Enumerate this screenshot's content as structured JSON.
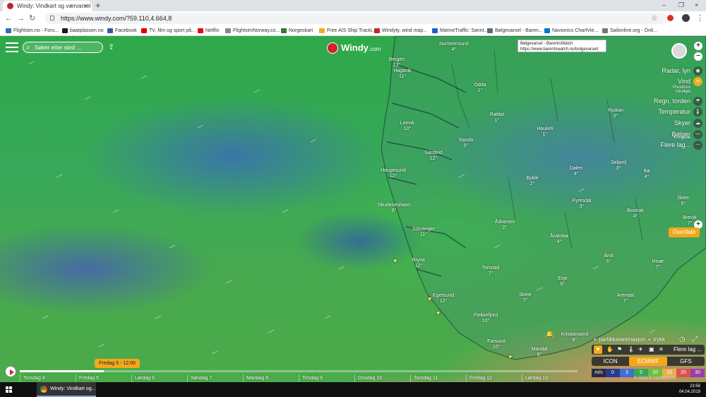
{
  "browser": {
    "tab_title": "Windy: Vindkart og værvarsel",
    "tab_close": "×",
    "new_tab": "+",
    "url": "https://www.windy.com/?59.110,4.664,8",
    "window_controls": [
      "–",
      "❐",
      "×"
    ],
    "bookmarks": [
      {
        "label": "Flightsim.no - Foru...",
        "color": "#2d6db5"
      },
      {
        "label": "baatplassen.no",
        "color": "#1a1a1a"
      },
      {
        "label": "Facebook",
        "color": "#3b5998"
      },
      {
        "label": "TV, film og sport på...",
        "color": "#e00000"
      },
      {
        "label": "Netflix",
        "color": "#e50914"
      },
      {
        "label": "FlightsimNorway.co...",
        "color": "#888888"
      },
      {
        "label": "Norgeskart",
        "color": "#2e7d32"
      },
      {
        "label": "Free AIS Ship Tracki...",
        "color": "#f9a825"
      },
      {
        "label": "Windyty, wind map...",
        "color": "#c0262b"
      },
      {
        "label": "MarineTraffic: Sannt...",
        "color": "#1565c0"
      },
      {
        "label": "Bølgevarsel - Baren...",
        "color": "#546e7a"
      },
      {
        "label": "Navionics ChartVie...",
        "color": "#0277bd"
      },
      {
        "label": "Sailonline.org - Onli...",
        "color": "#777777"
      }
    ]
  },
  "map": {
    "search_placeholder": "Søker etter sted ...",
    "logo_main": "Windy",
    "logo_suffix": ".com",
    "tooltip_title": "Bølgevarsel - BarentsWatch",
    "tooltip_url": "https://www.barentswatch.no/bolgevarsel/",
    "cities": [
      {
        "name": "Bergen",
        "temp": "13°"
      },
      {
        "name": "Norheimsund",
        "temp": "4°"
      },
      {
        "name": "Hagavik",
        "temp": "11°"
      },
      {
        "name": "Odda",
        "temp": "1°"
      },
      {
        "name": "Røldal",
        "temp": "1°"
      },
      {
        "name": "Rjukan",
        "temp": "0°"
      },
      {
        "name": "Leirvik",
        "temp": "10°"
      },
      {
        "name": "Haukeli",
        "temp": "1°"
      },
      {
        "name": "Sauda",
        "temp": "5°"
      },
      {
        "name": "Sandeid",
        "temp": "12°"
      },
      {
        "name": "Haugesund",
        "temp": "12°"
      },
      {
        "name": "Dalen",
        "temp": "4°"
      },
      {
        "name": "Seljord",
        "temp": "3°"
      },
      {
        "name": "Bø",
        "temp": "4°"
      },
      {
        "name": "Bykle",
        "temp": "2°"
      },
      {
        "name": "Skudeneshavn",
        "temp": "9°"
      },
      {
        "name": "Fyresdal",
        "temp": "3°"
      },
      {
        "name": "Skien",
        "temp": "6°"
      },
      {
        "name": "Bostrak",
        "temp": "4°"
      },
      {
        "name": "Brevik",
        "temp": "7°"
      },
      {
        "name": "Ådneram",
        "temp": "2°"
      },
      {
        "name": "Stavanger",
        "temp": "11°"
      },
      {
        "name": "Åraksbø",
        "temp": "4°"
      },
      {
        "name": "Åmli",
        "temp": "5°"
      },
      {
        "name": "Risør",
        "temp": "7°"
      },
      {
        "name": "Bryne",
        "temp": "12°"
      },
      {
        "name": "Tonstad",
        "temp": "7°"
      },
      {
        "name": "Evje",
        "temp": "6°"
      },
      {
        "name": "Egersund",
        "temp": "12°"
      },
      {
        "name": "Arendal",
        "temp": "7°"
      },
      {
        "name": "Skeie",
        "temp": "7°"
      },
      {
        "name": "Flekkefjord",
        "temp": "10°"
      },
      {
        "name": "Kristiansand",
        "temp": "8°"
      },
      {
        "name": "Farsund",
        "temp": "10°"
      },
      {
        "name": "Mandal",
        "temp": "8°"
      }
    ],
    "layers": [
      "Radar, lyn",
      "Vind",
      "Regn, torden",
      "Temperatur",
      "Skyer",
      "Bølger",
      "Flere lag..."
    ],
    "layer_overlaps": [
      "Prestfoss",
      "Vindkjet",
      "Kongsbe"
    ],
    "zoom_in": "+",
    "zoom_out": "−",
    "zoom_plus_lower": "+",
    "overflate": "Overflate",
    "particle_toggle": "partikkelanimasjon",
    "pressure_toggle": "trykk",
    "more_layers": "Flere lag ...",
    "models": [
      "ICON",
      "ECMWF",
      "GFS"
    ],
    "active_model": "ECMWF",
    "legend_unit": "m/s",
    "legend_values": [
      "0",
      "3",
      "5",
      "10",
      "15",
      "20",
      "30"
    ],
    "legend_colors": [
      "#2a3b8f",
      "#3f6fd1",
      "#34a853",
      "#6cbf3b",
      "#e8b04b",
      "#d9534f",
      "#9b3fa8"
    ],
    "attribution": "© OSM & contributors"
  },
  "timeline": {
    "current": "Fredag 5 - 12:00",
    "days": [
      "Torsdag 4",
      "Fredag 5",
      "Lørdag 6",
      "Søndag 7",
      "Mandag 8",
      "Tirsdag 9",
      "Onsdag 10",
      "Torsdag 11",
      "Fredag 12",
      "Lørdag 13"
    ],
    "progress": 0.15
  },
  "taskbar": {
    "app_label": "Windy: Vindkart og...",
    "time": "23:56",
    "date": "04.04.2019"
  }
}
